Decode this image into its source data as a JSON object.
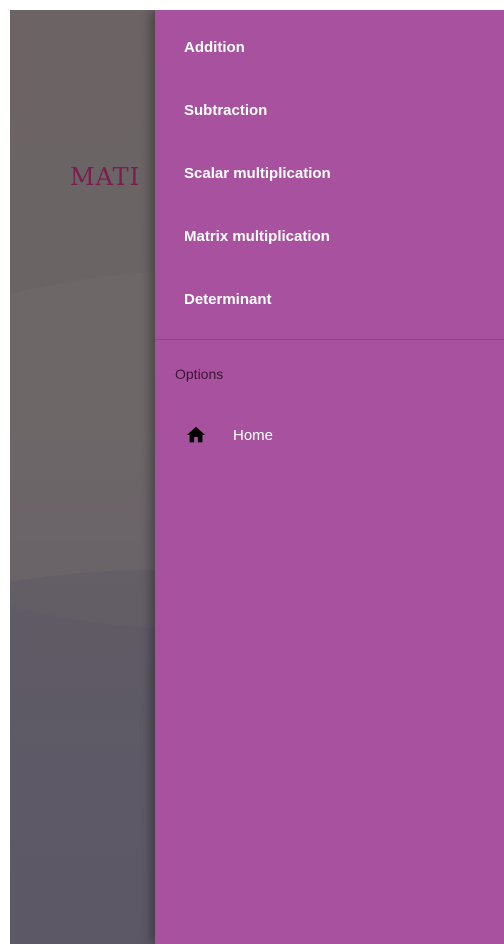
{
  "background": {
    "title_partial": "MATI"
  },
  "drawer": {
    "items": [
      {
        "label": "Addition"
      },
      {
        "label": "Subtraction"
      },
      {
        "label": "Scalar multiplication"
      },
      {
        "label": "Matrix multiplication"
      },
      {
        "label": "Determinant"
      }
    ],
    "section_label": "Options",
    "home": {
      "label": "Home",
      "icon": "home-icon"
    }
  },
  "colors": {
    "drawer": "#a8519f",
    "scrim": "#6a6466",
    "title": "#7a1d4f"
  }
}
